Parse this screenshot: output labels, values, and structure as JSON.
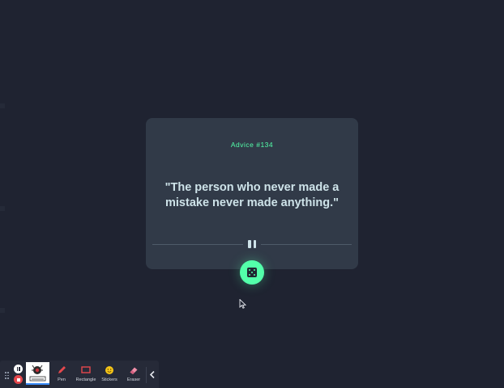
{
  "advice": {
    "id_label": "Advice #134",
    "quote_text": "\"The person who never made a mistake never made anything.\""
  },
  "colors": {
    "background": "#1f2331",
    "card": "#313a48",
    "accent": "#53ffaa",
    "quote_text": "#cee3e9",
    "toolbar": "#262a38"
  },
  "icons": {
    "divider": "pause-icon",
    "generate": "dice-icon"
  },
  "toolbar": {
    "tools": [
      {
        "label": "Pen",
        "icon": "pen-icon"
      },
      {
        "label": "Rectangle",
        "icon": "rectangle-icon"
      },
      {
        "label": "Stickers",
        "icon": "sticker-icon"
      },
      {
        "label": "Eraser",
        "icon": "eraser-icon"
      }
    ]
  }
}
